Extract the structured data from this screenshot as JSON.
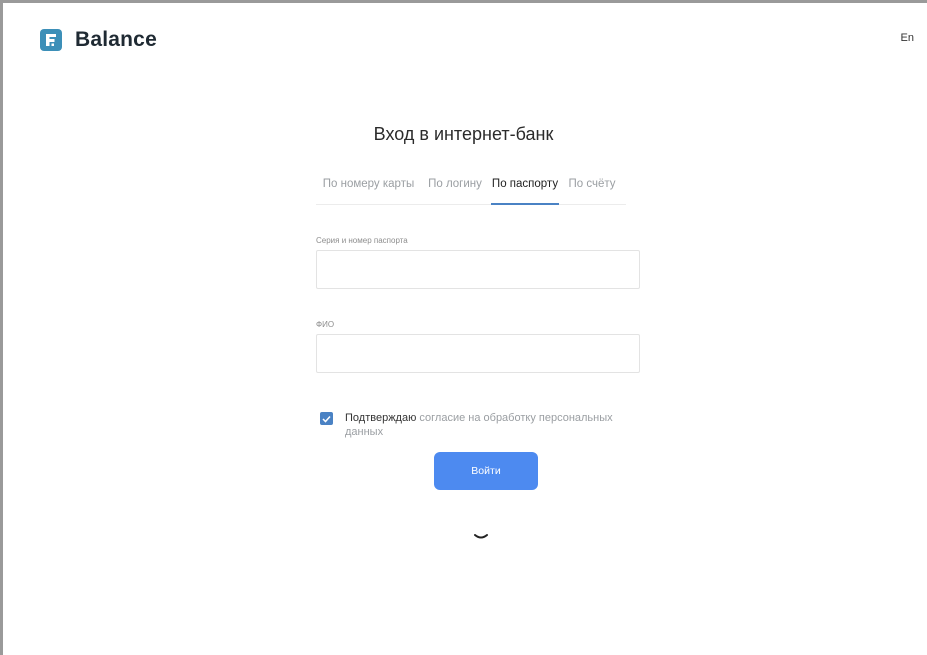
{
  "brand": {
    "name": "Balance",
    "icon": "f-logo-icon",
    "color": "#3c8fb8"
  },
  "header": {
    "language_switch": "En"
  },
  "page": {
    "title": "Вход в интернет-банк"
  },
  "tabs": [
    {
      "label": "По номеру карты",
      "active": false
    },
    {
      "label": "По логину",
      "active": false
    },
    {
      "label": "По паспорту",
      "active": true
    },
    {
      "label": "По счёту",
      "active": false
    }
  ],
  "form": {
    "passport_label": "Серия и номер паспорта",
    "passport_value": "",
    "fio_label": "ФИО",
    "fio_value": "",
    "consent_checked": true,
    "consent_prefix": "Подтверждаю",
    "consent_link": "согласие на обработку персональных данных",
    "submit_label": "Войти"
  },
  "scroll_hint_icon": "chevron-down-icon",
  "colors": {
    "accent": "#4a82c4",
    "button": "#4d8af0"
  }
}
